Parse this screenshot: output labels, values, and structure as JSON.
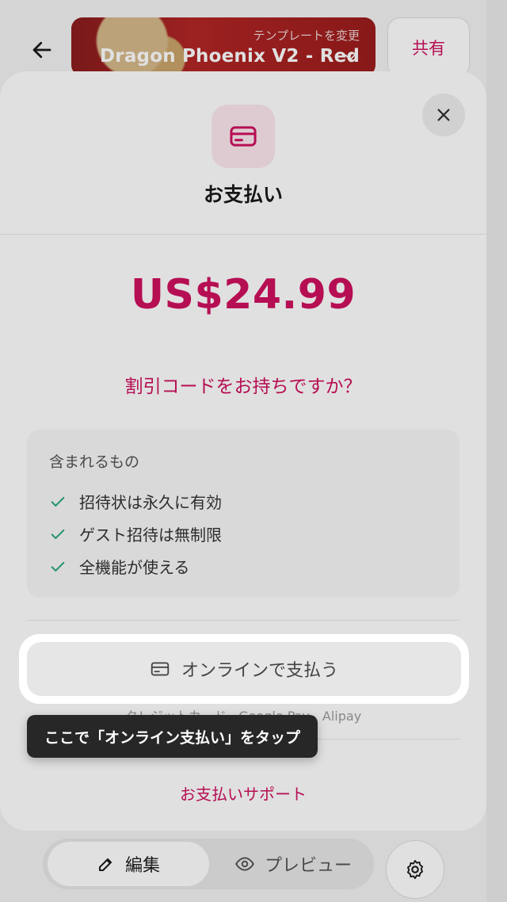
{
  "header": {
    "template_hint": "テンプレートを変更",
    "template_name": "Dragon Phoenix V2 - Red",
    "share_label": "共有"
  },
  "sheet": {
    "title": "お支払い",
    "price": "US$24.99",
    "promo_link": "割引コードをお持ちですか？",
    "included": {
      "heading": "含まれるもの",
      "items": [
        {
          "label": "招待状は永久に有効"
        },
        {
          "label": "ゲスト招待は無制限"
        },
        {
          "label": "全機能が使える"
        }
      ]
    },
    "pay_button_label": "オンラインで支払う",
    "payment_methods": "クレジットカード、Google Pay、Alipay",
    "support_link": "お支払いサポート"
  },
  "tooltip": {
    "text": "ここで「オンライン支払い」をタップ"
  },
  "bottom_bar": {
    "edit_label": "編集",
    "preview_label": "プレビュー"
  },
  "colors": {
    "accent": "#d0105f",
    "check": "#2aa87a",
    "tooltip_bg": "#272727"
  },
  "icons": {
    "back": "arrow-left-icon",
    "chevron": "chevron-down-icon",
    "close": "close-icon",
    "card": "credit-card-icon",
    "check": "check-icon",
    "edit": "pencil-icon",
    "preview": "eye-icon",
    "settings": "gear-icon"
  }
}
